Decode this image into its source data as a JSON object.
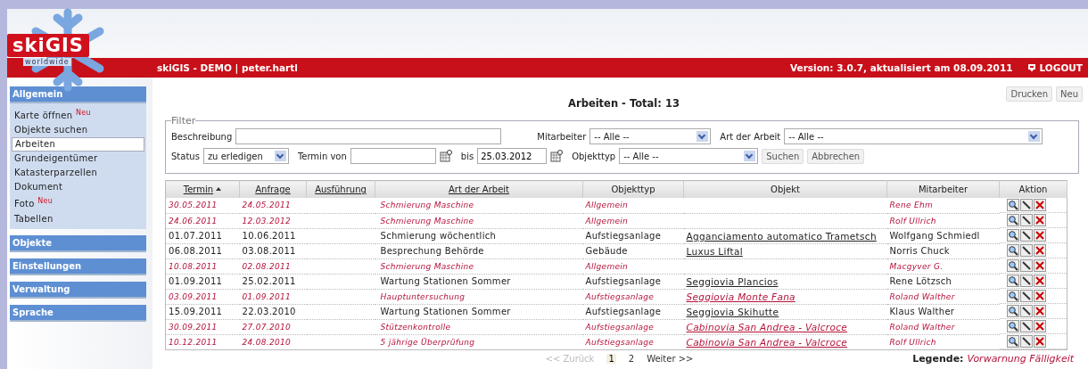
{
  "header": {
    "logo_text": "skiGIS",
    "logo_tagline": "worldwide",
    "user_line": "skiGIS - DEMO | peter.hartl",
    "version": "Version: 3.0.7, aktualisiert am 08.09.2011",
    "logout": "LOGOUT"
  },
  "sidebar": [
    {
      "title": "Allgemein",
      "items": [
        {
          "label": "Karte öffnen",
          "badge": "Neu",
          "selected": false
        },
        {
          "label": "Objekte suchen",
          "selected": false
        },
        {
          "label": "Arbeiten",
          "selected": true
        },
        {
          "label": "Grundeigentümer",
          "selected": false
        },
        {
          "label": "Katasterparzellen",
          "selected": false
        },
        {
          "label": "Dokument",
          "selected": false
        },
        {
          "label": "Foto",
          "badge": "Neu",
          "selected": false
        },
        {
          "label": "Tabellen",
          "selected": false
        }
      ]
    },
    {
      "title": "Objekte"
    },
    {
      "title": "Einstellungen"
    },
    {
      "title": "Verwaltung"
    },
    {
      "title": "Sprache"
    }
  ],
  "page_title": "Arbeiten - Total: 13",
  "top_buttons": [
    "Drucken",
    "Neu"
  ],
  "filter": {
    "legend": "Filter",
    "beschreibung": {
      "label": "Beschreibung"
    },
    "mitarbeiter": {
      "label": "Mitarbeiter",
      "value": "-- Alle --"
    },
    "art": {
      "label": "Art der Arbeit",
      "value": "-- Alle --"
    },
    "status": {
      "label": "Status",
      "value": "zu erledigen"
    },
    "termin_von": {
      "label": "Termin von"
    },
    "termin_bis": {
      "label": "bis",
      "value": "25.03.2012"
    },
    "objekttyp": {
      "label": "Objekttyp",
      "value": "-- Alle --"
    },
    "buttons": [
      "Suchen",
      "Abbrechen"
    ]
  },
  "table": {
    "columns": [
      {
        "label": "Termin",
        "sortable": true,
        "sorted_ascending": true
      },
      {
        "label": "Anfrage",
        "sortable": true
      },
      {
        "label": "Ausführung",
        "sortable": true
      },
      {
        "label": "Art der Arbeit",
        "sortable": true
      },
      {
        "label": "Objekttyp",
        "sortable": false
      },
      {
        "label": "Objekt",
        "sortable": false
      },
      {
        "label": "Mitarbeiter",
        "sortable": false
      },
      {
        "label": "Aktion",
        "sortable": false
      }
    ],
    "rows": [
      {
        "termin": "30.05.2011",
        "anfrage": "24.05.2011",
        "art": "Schmierung Maschine",
        "objekttyp": "Allgemein",
        "objekt": "",
        "mitarbeiter": "Rene Ehm",
        "warning": true
      },
      {
        "termin": "24.06.2011",
        "anfrage": "12.03.2012",
        "art": "Schmierung Maschine",
        "objekttyp": "Allgemein",
        "objekt": "",
        "mitarbeiter": "Rolf Ullrich",
        "warning": true
      },
      {
        "termin": "01.07.2011",
        "anfrage": "10.06.2011",
        "art": "Schmierung wöchentlich",
        "objekttyp": "Aufstiegsanlage",
        "objekt": "Agganciamento automatico Trametsch",
        "mitarbeiter": "Wolfgang Schmiedl",
        "warning": false
      },
      {
        "termin": "06.08.2011",
        "anfrage": "03.08.2011",
        "art": "Besprechung Behörde",
        "objekttyp": "Gebäude",
        "objekt": "Luxus Liftal",
        "mitarbeiter": "Norris Chuck",
        "warning": false
      },
      {
        "termin": "10.08.2011",
        "anfrage": "02.08.2011",
        "art": "Schmierung Maschine",
        "objekttyp": "Allgemein",
        "objekt": "",
        "mitarbeiter": "Macgyver G.",
        "warning": true
      },
      {
        "termin": "01.09.2011",
        "anfrage": "25.02.2011",
        "art": "Wartung Stationen Sommer",
        "objekttyp": "Aufstiegsanlage",
        "objekt": "Seggiovia Plancios",
        "mitarbeiter": "Rene Lötzsch",
        "warning": false
      },
      {
        "termin": "03.09.2011",
        "anfrage": "01.09.2011",
        "art": "Hauptuntersuchung",
        "objekttyp": "Aufstiegsanlage",
        "objekt": "Seggiovia Monte Fana",
        "mitarbeiter": "Roland Walther",
        "warning": true
      },
      {
        "termin": "15.09.2011",
        "anfrage": "22.03.2010",
        "art": "Wartung Stationen Sommer",
        "objekttyp": "Aufstiegsanlage",
        "objekt": "Seggiovia Skihutte",
        "mitarbeiter": "Klaus Walther",
        "warning": false
      },
      {
        "termin": "30.09.2011",
        "anfrage": "27.07.2010",
        "art": "Stützenkontrolle",
        "objekttyp": "Aufstiegsanlage",
        "objekt": "Cabinovia San Andrea - Valcroce",
        "mitarbeiter": "Roland Walther",
        "warning": true
      },
      {
        "termin": "10.12.2011",
        "anfrage": "24.08.2010",
        "art": "5 jährige Überprüfung",
        "objekttyp": "Aufstiegsanlage",
        "objekt": "Cabinovia San Andrea - Valcroce",
        "mitarbeiter": "Rolf Ullrich",
        "warning": true
      }
    ]
  },
  "pagination": [
    {
      "label": "<< Zurück",
      "disabled": true,
      "selected": false
    },
    {
      "label": "1",
      "selected": true
    },
    {
      "label": "2",
      "selected": false
    },
    {
      "label": "Weiter >>",
      "selected": false
    }
  ],
  "legend": {
    "label": "Legende:",
    "value": "Vorwarnung Fälligkeit"
  }
}
